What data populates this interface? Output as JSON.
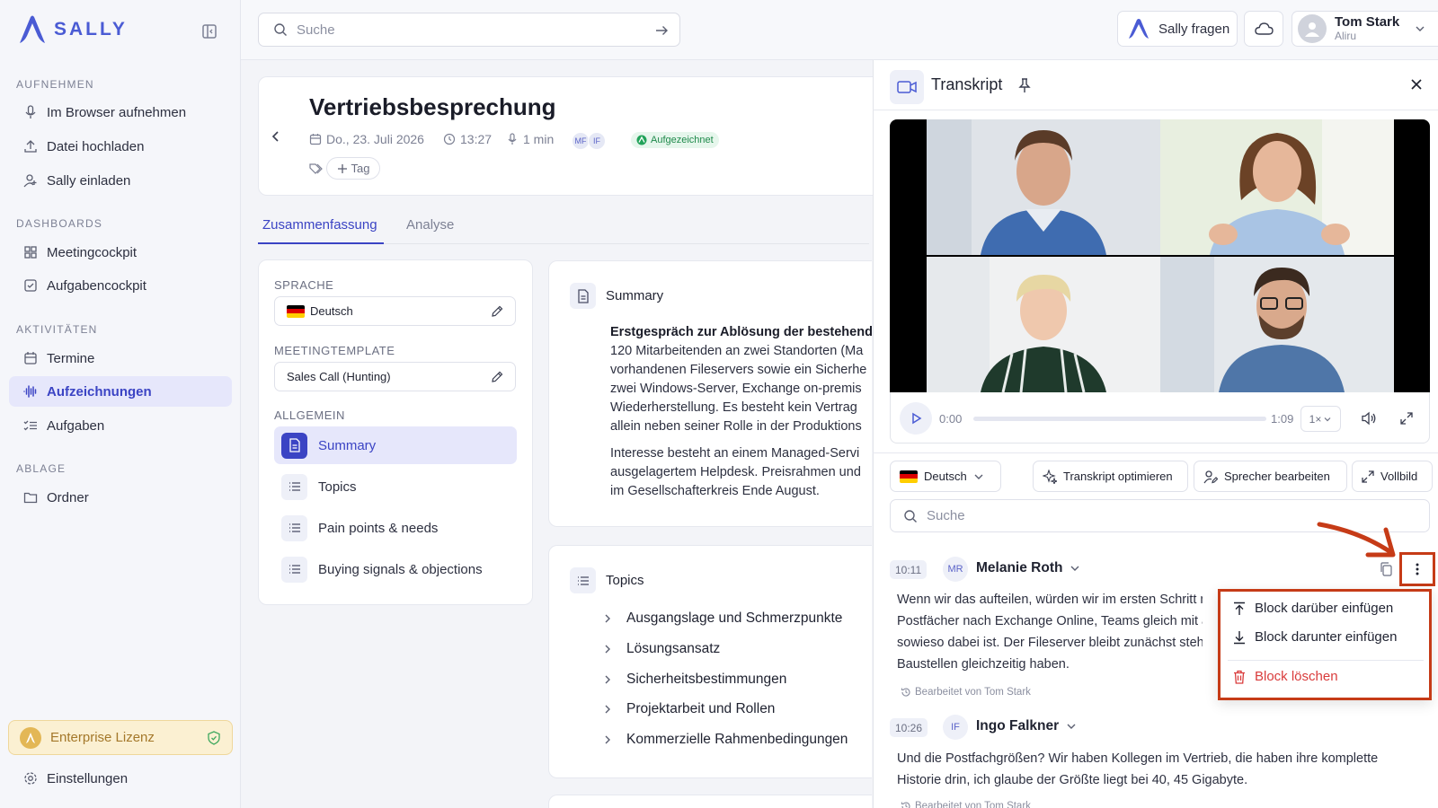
{
  "sidebar": {
    "brand": "SALLY",
    "sections": [
      {
        "title": "AUFNEHMEN",
        "items": [
          "Im Browser aufnehmen",
          "Datei hochladen",
          "Sally einladen"
        ]
      },
      {
        "title": "DASHBOARDS",
        "items": [
          "Meetingcockpit",
          "Aufgabencockpit"
        ]
      },
      {
        "title": "AKTIVITÄTEN",
        "items": [
          "Termine",
          "Aufzeichnungen",
          "Aufgaben"
        ]
      },
      {
        "title": "ABLAGE",
        "items": [
          "Ordner"
        ]
      }
    ],
    "active_item": "Aufzeichnungen",
    "license": "Enterprise Lizenz",
    "settings": "Einstellungen"
  },
  "topbar": {
    "search_placeholder": "Suche",
    "ask_label": "Sally fragen",
    "user_name": "Tom Stark",
    "user_company": "Aliru"
  },
  "meeting": {
    "title": "Vertriebsbesprechung",
    "date": "Do., 23. Juli 2026",
    "time": "13:27",
    "duration": "1 min",
    "participants": [
      "MF",
      "IF"
    ],
    "status": "Aufgezeichnet",
    "add_tag": "Tag"
  },
  "tabs": [
    "Zusammenfassung",
    "Analyse"
  ],
  "settings": {
    "language_label": "SPRACHE",
    "language": "Deutsch",
    "template_label": "MEETINGTEMPLATE",
    "template": "Sales Call (Hunting)",
    "general_label": "ALLGEMEIN",
    "items": [
      "Summary",
      "Topics",
      "Pain points & needs",
      "Buying signals & objections"
    ]
  },
  "summary": {
    "title": "Summary",
    "heading": "Erstgespräch zur Ablösung der bestehend",
    "lines": [
      "120 Mitarbeitenden an zwei Standorten (Ma",
      "vorhandenen Fileservers sowie ein Sicherhe",
      "zwei Windows-Server, Exchange on-premis",
      "Wiederherstellung. Es besteht kein Vertrag",
      "allein neben seiner Rolle in der Produktions"
    ],
    "para2": [
      "Interesse besteht an einem Managed-Servi",
      "ausgelagertem Helpdesk. Preisrahmen und",
      "im Gesellschafterkreis Ende August."
    ]
  },
  "topics": {
    "title": "Topics",
    "items": [
      "Ausgangslage und Schmerzpunkte",
      "Lösungsansatz",
      "Sicherheitsbestimmungen",
      "Projektarbeit und Rollen",
      "Kommerzielle Rahmenbedingungen"
    ]
  },
  "transcript": {
    "title": "Transkript",
    "player": {
      "current": "0:00",
      "total": "1:09",
      "speed": "1×",
      "progress": 0
    },
    "language": "Deutsch",
    "optimize": "Transkript optimieren",
    "speakers": "Sprecher bearbeiten",
    "fullscreen": "Vollbild",
    "search_placeholder": "Suche",
    "blocks": [
      {
        "time": "10:11",
        "initials": "MR",
        "speaker": "Melanie Roth",
        "lines": [
          "Wenn wir das aufteilen, würden wir im ersten Schritt n",
          "Postfächer nach Exchange Online, Teams gleich mit a",
          "sowieso dabei ist. Der Fileserver bleibt zunächst steh",
          "Baustellen gleichzeitig haben."
        ],
        "edited": "Bearbeitet von Tom Stark"
      },
      {
        "time": "10:26",
        "initials": "IF",
        "speaker": "Ingo Falkner",
        "lines": [
          "Und die Postfachgrößen? Wir haben Kollegen im Vertrieb, die haben ihre komplette",
          "Historie drin, ich glaube der Größte liegt bei 40, 45 Gigabyte."
        ],
        "edited": "Bearbeitet von Tom Stark"
      }
    ],
    "menu": [
      "Block darüber einfügen",
      "Block darunter einfügen",
      "Block löschen"
    ]
  },
  "colors": {
    "accent": "#3b44c4",
    "highlight": "#c63b17",
    "danger": "#d93b3b",
    "license": "#a4782a"
  }
}
